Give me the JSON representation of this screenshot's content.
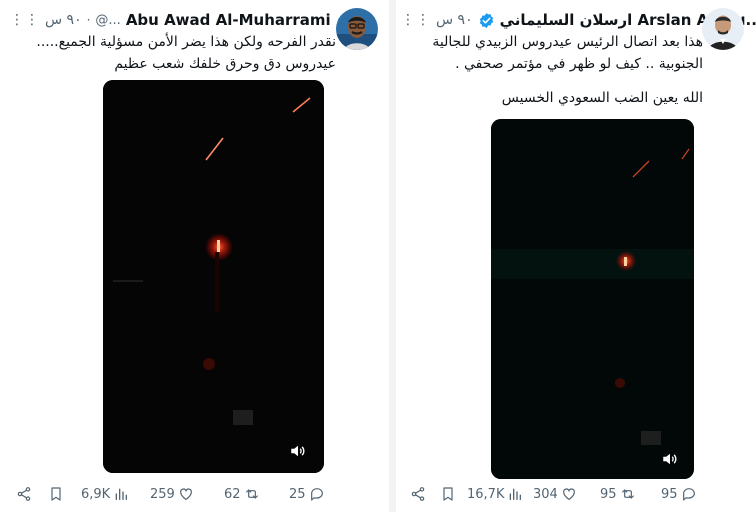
{
  "left": {
    "display_name": "Abu Awad Al-Muharrami",
    "handle": "@...",
    "time": "٩٠ س",
    "more": "⋮⋮",
    "text": [
      "نقدر الفرحه ولكن هذا يضر الأمن مسؤلية الجميع.....",
      "عيدروس دق وحرق خلفك شعب عظيم"
    ],
    "stats": {
      "share": "",
      "views": "6,9K",
      "likes": "259",
      "retweets": "62",
      "replies": "25"
    }
  },
  "right": {
    "display_name": "ارسلان السليماني Arslan AL-Su...",
    "time": "٩٠ س",
    "more": "⋮⋮",
    "text": [
      "هذا بعد اتصال الرئيس عيدروس الزبيدي للجالية",
      "الجنوبية .. كيف لو ظهر في مؤتمر صحفي .",
      "الله يعين الضب السعودي الخسيس"
    ],
    "stats": {
      "views": "16,7K",
      "likes": "304",
      "retweets": "95",
      "replies": "95"
    }
  },
  "colors": {
    "accent": "#1d9bf0",
    "muted": "#536471",
    "text": "#0f1419"
  },
  "icons": [
    "verified-badge-icon",
    "volume-icon",
    "share-icon",
    "bookmark-icon",
    "views-icon",
    "like-icon",
    "retweet-icon",
    "reply-icon",
    "more-icon"
  ]
}
